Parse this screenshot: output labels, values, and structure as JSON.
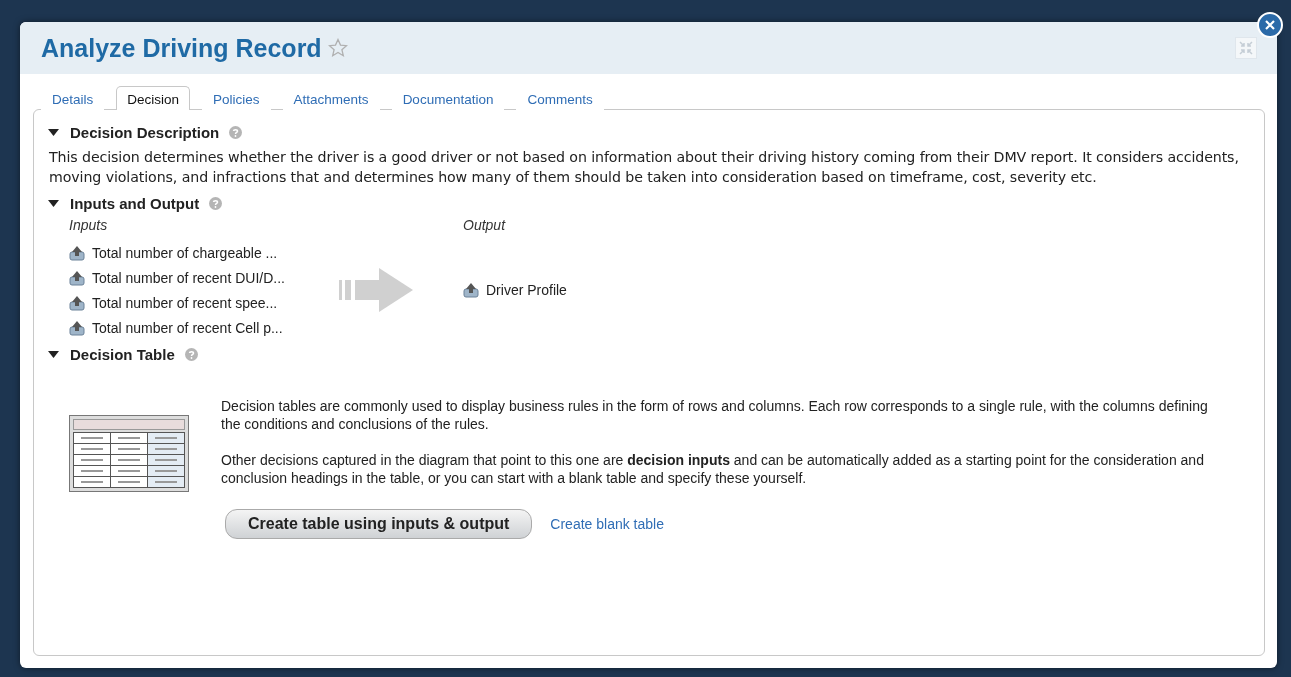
{
  "dialog": {
    "title": "Analyze Driving Record",
    "favorite": false
  },
  "tabs": [
    {
      "label": "Details",
      "selected": false
    },
    {
      "label": "Decision",
      "selected": true
    },
    {
      "label": "Policies",
      "selected": false
    },
    {
      "label": "Attachments",
      "selected": false
    },
    {
      "label": "Documentation",
      "selected": false
    },
    {
      "label": "Comments",
      "selected": false
    }
  ],
  "description": {
    "heading": "Decision Description",
    "expanded": true,
    "text": "This decision determines whether the driver is a good driver or not based on information about their driving history coming from their DMV report. It considers accidents, moving violations, and infractions that and determines how many of them should be taken into consideration based on timeframe, cost, severity etc."
  },
  "inputs_output": {
    "heading": "Inputs and Output",
    "expanded": true,
    "inputs_label": "Inputs",
    "output_label": "Output",
    "inputs": [
      "Total number of chargeable ...",
      "Total number of recent DUI/D...",
      "Total number of recent spee...",
      "Total number of recent Cell p..."
    ],
    "output": "Driver Profile"
  },
  "decision_table": {
    "heading": "Decision Table",
    "expanded": true,
    "paragraphs": [
      "Decision tables are commonly used to display business rules in the form of rows and columns. Each row corresponds to a single rule, with the columns defining the conditions and conclusions of the rules.",
      "Other decisions captured in the diagram that point to this one are **decision inputs** and can be automatically added as a starting point for the consideration and conclusion headings in the table, or you can start with a blank table and specify these yourself."
    ],
    "primary_button": "Create table using inputs & output",
    "link": "Create blank table"
  }
}
